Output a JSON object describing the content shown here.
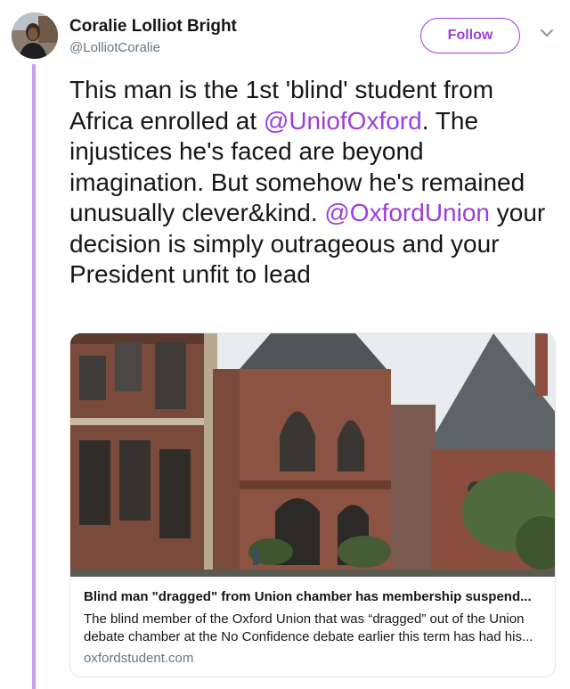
{
  "tweet": {
    "author_name": "Coralie Lolliot Bright",
    "author_handle": "@LolliotCoralie",
    "follow_label": "Follow",
    "text_parts": [
      "This man is the 1st 'blind' student from Africa enrolled at ",
      "@UniofOxford",
      ". The injustices he's faced are beyond imagination. But somehow he's remained unusually clever&kind. ",
      "@OxfordUnion",
      " your decision is simply outrageous and your President unfit to lead"
    ]
  },
  "card": {
    "title": "Blind man \"dragged\" from Union chamber has membership suspend...",
    "description": "The blind member of the Oxford Union that was “dragged” out of the Union debate chamber at the No Confidence debate earlier this term has had his...",
    "domain": "oxfordstudent.com"
  },
  "colors": {
    "accent": "#9b3fd6",
    "thread_line": "#c5a3e6",
    "secondary_text": "#657786"
  },
  "icons": {
    "more": "chevron-down-icon"
  }
}
